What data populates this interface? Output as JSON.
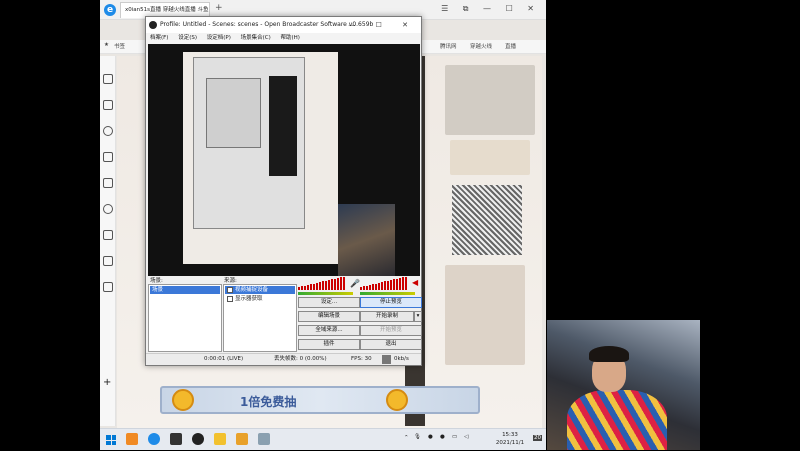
{
  "browser": {
    "tab_title": "x0ian51s直播 穿越火线直播 斗鱼",
    "new_tab": "+",
    "bookmark_label": "书签",
    "right_bookmarks": [
      "腾讯网",
      "穿越火线",
      "直播"
    ]
  },
  "obs": {
    "title": "Profile: Untitled - Scenes: scenes - Open Broadcaster Software v0.659b",
    "menu": [
      "档案(F)",
      "设定(S)",
      "设定档(P)",
      "场景集合(C)",
      "帮助(H)"
    ],
    "scenes_label": "场景:",
    "sources_label": "来源:",
    "scenes": [
      "场景"
    ],
    "sources": [
      {
        "label": "视频捕捉设备",
        "selected": true
      },
      {
        "label": "显示器获取",
        "selected": false
      }
    ],
    "buttons": {
      "settings": "设定...",
      "stop_preview": "停止预览",
      "edit_scene": "编辑场景",
      "start_recording": "开始录制",
      "global_sources": "全域来源...",
      "plugins": "插件",
      "start_preview": "开始预览",
      "exit": "退出"
    },
    "status": {
      "time": "0:00:01 (LIVE)",
      "dropped": "丢失帧数: 0 (0.00%)",
      "fps": "FPS: 30",
      "bitrate": "0kb/s"
    }
  },
  "web": {
    "banner": "1倍免费抽"
  },
  "taskbar": {
    "time": "15:33",
    "date": "2021/11/1",
    "notifications": "20"
  },
  "colors": {
    "accent": "#3b78d8",
    "meter": "#cc0000",
    "live_button": "#dbe8fa"
  }
}
